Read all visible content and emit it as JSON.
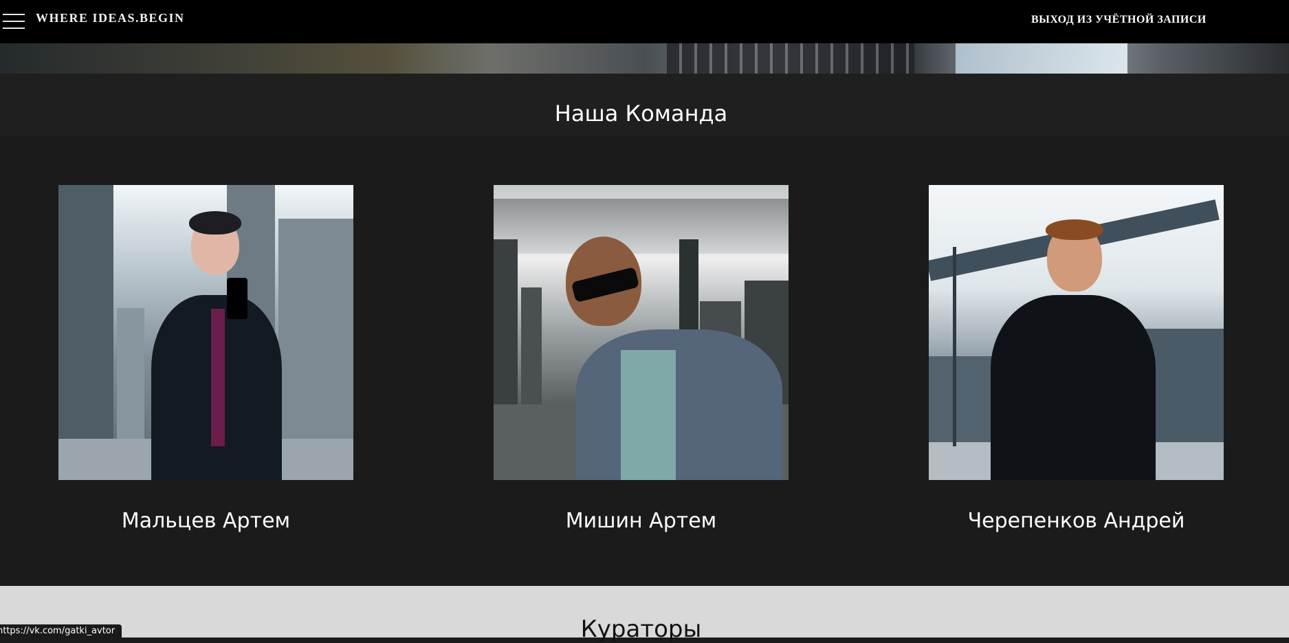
{
  "header": {
    "brand": "WHERE IDEAS.BEGIN",
    "logout_label": "ВЫХОД ИЗ УЧЁТНОЙ ЗАПИСИ"
  },
  "team": {
    "title": "Наша Команда",
    "members": [
      {
        "name": "Мальцев Артем"
      },
      {
        "name": "Мишин Артем"
      },
      {
        "name": "Черепенков Андрей"
      }
    ]
  },
  "curators": {
    "title": "Кураторы"
  },
  "status_bar": {
    "url": "https://vk.com/gatki_avtor"
  }
}
